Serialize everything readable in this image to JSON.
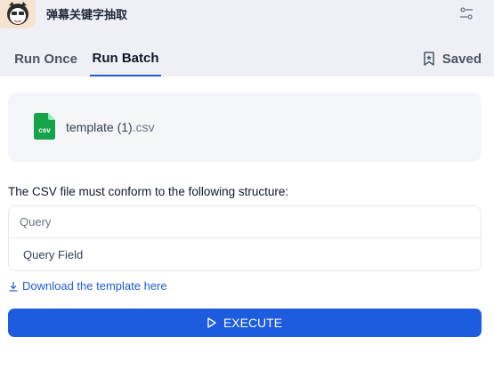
{
  "app": {
    "title": "弹幕关键字抽取"
  },
  "tabs": [
    {
      "label": "Run Once",
      "active": false
    },
    {
      "label": "Run Batch",
      "active": true
    }
  ],
  "saved": {
    "label": "Saved"
  },
  "file": {
    "name": "template (1)",
    "ext": ".csv",
    "icon_text": "csv"
  },
  "structure": {
    "description": "The CSV file must conform to the following structure:",
    "header": "Query",
    "rows": [
      "Query Field"
    ]
  },
  "download": {
    "label": "Download the template here"
  },
  "execute": {
    "label": "EXECUTE"
  },
  "colors": {
    "accent": "#1d5bdf",
    "csv_green": "#16a34a",
    "topbar_bg": "#eef0f5"
  }
}
